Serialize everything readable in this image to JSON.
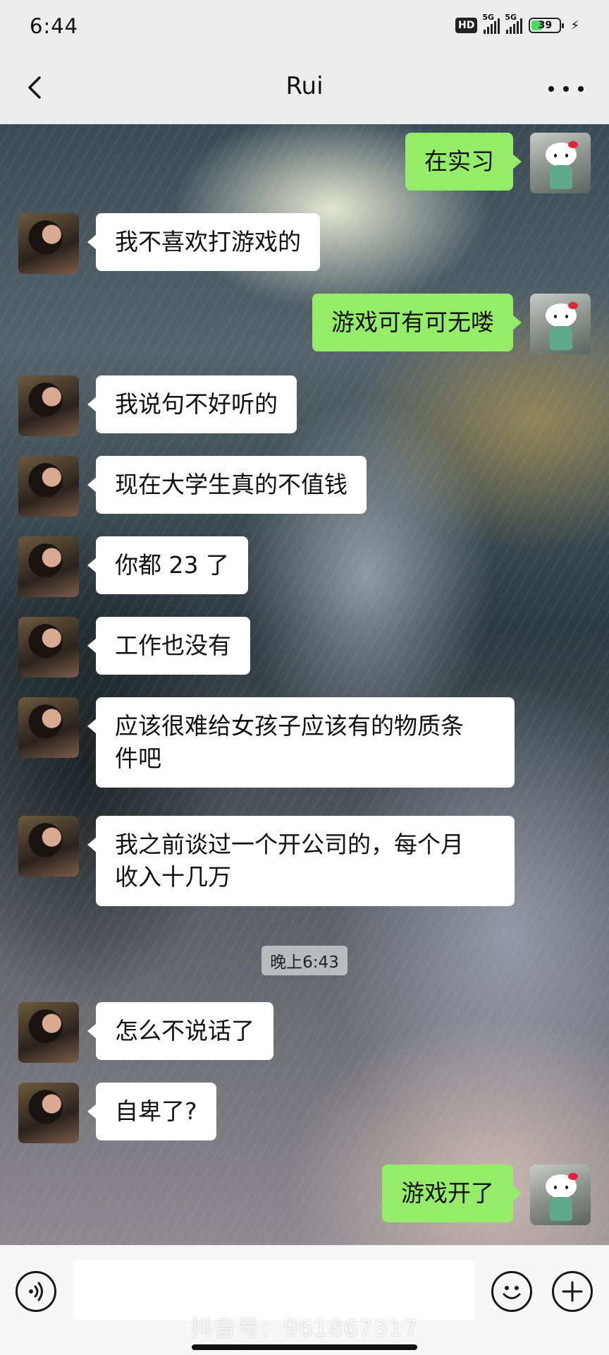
{
  "status_bar": {
    "time": "6:44",
    "hd_label": "HD",
    "signal1_label": "5G",
    "signal2_label": "5G",
    "battery_percent": "39",
    "battery_level": 0.39,
    "charging": true
  },
  "header": {
    "title": "Rui",
    "back_icon": "chevron-left-icon",
    "more_icon": "more-dots-icon"
  },
  "messages": [
    {
      "side": "out",
      "text": "在实习"
    },
    {
      "side": "in",
      "text": "我不喜欢打游戏的"
    },
    {
      "side": "out",
      "text": "游戏可有可无喽"
    },
    {
      "side": "in",
      "text": "我说句不好听的"
    },
    {
      "side": "in",
      "text": "现在大学生真的不值钱"
    },
    {
      "side": "in",
      "text": "你都 23 了"
    },
    {
      "side": "in",
      "text": "工作也没有"
    },
    {
      "side": "in",
      "text_lines": [
        "应该很难给女孩子应该有的物质条",
        "件吧"
      ]
    },
    {
      "side": "in",
      "text_lines": [
        "我之前谈过一个开公司的，每个月",
        "收入十几万"
      ]
    },
    {
      "side": "in",
      "text": "怎么不说话了"
    },
    {
      "side": "in",
      "text": "自卑了?"
    },
    {
      "side": "out",
      "text": "游戏开了"
    }
  ],
  "timestamp": "晚上6:43",
  "input_bar": {
    "voice_icon": "voice-icon",
    "emoji_icon": "emoji-icon",
    "plus_icon": "plus-icon",
    "input_value": "",
    "watermark": "抖音号：961867317"
  },
  "colors": {
    "bubble_out": "#95ec69",
    "bubble_in": "#ffffff",
    "bar_bg": "#ededed"
  }
}
